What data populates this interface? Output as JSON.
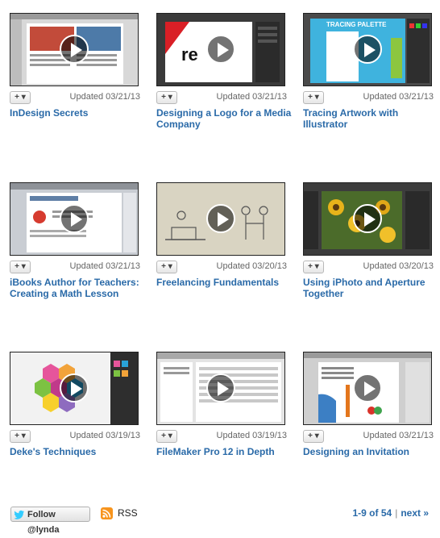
{
  "courses": [
    {
      "title": "InDesign Secrets",
      "updated": "Updated 03/21/13",
      "add_label": "+ ▾",
      "thumb": "indesign-layout"
    },
    {
      "title": "Designing a Logo for a Media Company",
      "updated": "Updated 03/21/13",
      "add_label": "+ ▾",
      "thumb": "redo-media-logo"
    },
    {
      "title": "Tracing Artwork with Illustrator",
      "updated": "Updated 03/21/13",
      "add_label": "+ ▾",
      "thumb": "tracing-palette"
    },
    {
      "title": "iBooks Author for Teachers: Creating a Math Lesson",
      "updated": "Updated 03/21/13",
      "add_label": "+ ▾",
      "thumb": "ibooks-author"
    },
    {
      "title": "Freelancing Fundamentals",
      "updated": "Updated 03/20/13",
      "add_label": "+ ▾",
      "thumb": "sketch-handshake"
    },
    {
      "title": "Using iPhoto and Aperture Together",
      "updated": "Updated 03/20/13",
      "add_label": "+ ▾",
      "thumb": "sunflowers-photo"
    },
    {
      "title": "Deke's Techniques",
      "updated": "Updated 03/19/13",
      "add_label": "+ ▾",
      "thumb": "hexagon-graphic"
    },
    {
      "title": "FileMaker Pro 12 in Depth",
      "updated": "Updated 03/19/13",
      "add_label": "+ ▾",
      "thumb": "filemaker-layout"
    },
    {
      "title": "Designing an Invitation",
      "updated": "Updated 03/21/13",
      "add_label": "+ ▾",
      "thumb": "invitation-layout"
    }
  ],
  "footer": {
    "follow_label": "Follow @lynda",
    "rss_label": "RSS",
    "pagination": "1-9 of 54",
    "separator": "|",
    "next_label": "next »"
  },
  "colors": {
    "link": "#2a6aa8",
    "rss": "#f7941d",
    "twitter": "#33ccff"
  }
}
